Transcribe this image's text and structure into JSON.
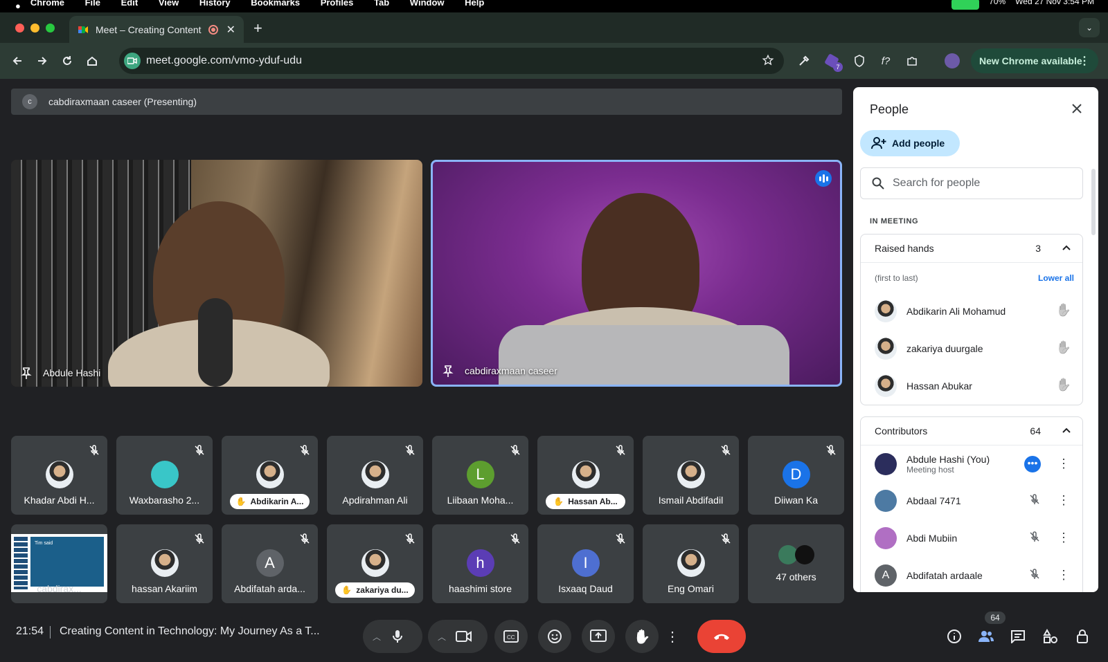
{
  "mac_menu": {
    "app": "Chrome",
    "items": [
      "File",
      "Edit",
      "View",
      "History",
      "Bookmarks",
      "Profiles",
      "Tab",
      "Window",
      "Help"
    ],
    "status_battery": "70%",
    "clock": "Wed 27 Nov  3:54 PM"
  },
  "browser": {
    "tab_title": "Meet – Creating Content i",
    "url": "meet.google.com/vmo-yduf-udu",
    "ext_badge": "7",
    "new_chrome_label": "New Chrome available"
  },
  "meet": {
    "presenting_initial": "c",
    "presenting_label": "cabdiraxmaan caseer (Presenting)",
    "featured": [
      {
        "name": "Abdule Hashi"
      },
      {
        "name": "cabdiraxmaan caseer"
      }
    ],
    "row1": [
      {
        "name": "Khadar Abdi H...",
        "type": "photo"
      },
      {
        "name": "Waxbarasho 2...",
        "type": "photo"
      },
      {
        "name": "Abdikarin A...",
        "type": "photo",
        "raised": true
      },
      {
        "name": "Apdirahman Ali",
        "type": "photo"
      },
      {
        "name": "Liibaan Moha...",
        "type": "letter",
        "letter": "L",
        "color": "#5d9e2f"
      },
      {
        "name": "Hassan Ab...",
        "type": "photo",
        "raised": true
      },
      {
        "name": "Ismail Abdifadil",
        "type": "photo"
      },
      {
        "name": "Diiwan Ka",
        "type": "letter",
        "letter": "D",
        "color": "#1a73e8"
      }
    ],
    "row2": [
      {
        "name": "cabdirax...",
        "type": "screen"
      },
      {
        "name": "hassan Akariim",
        "type": "photo"
      },
      {
        "name": "Abdifatah arda...",
        "type": "letter",
        "letter": "A",
        "color": "#5f6368"
      },
      {
        "name": "zakariya du...",
        "type": "photo",
        "raised": true
      },
      {
        "name": "haashimi store",
        "type": "letter",
        "letter": "h",
        "color": "#5b3db5"
      },
      {
        "name": "Isxaaq Daud",
        "type": "letter",
        "letter": "I",
        "color": "#4e6fd1"
      },
      {
        "name": "Eng Omari",
        "type": "photo"
      },
      {
        "name": "47 others",
        "type": "others"
      }
    ],
    "screen_preview_text": "Tim said",
    "time": "21:54",
    "meeting_title": "Creating Content in Technology: My Journey As a T...",
    "people_badge": "64"
  },
  "panel": {
    "title": "People",
    "add_people": "Add people",
    "search_placeholder": "Search for people",
    "in_meeting": "IN MEETING",
    "raised": {
      "label": "Raised hands",
      "count": "3",
      "order": "(first to last)",
      "lower_all": "Lower all",
      "people": [
        {
          "name": "Abdikarin Ali Mohamud"
        },
        {
          "name": "zakariya duurgale"
        },
        {
          "name": "Hassan Abukar"
        }
      ]
    },
    "contributors": {
      "label": "Contributors",
      "count": "64",
      "people": [
        {
          "name": "Abdule Hashi (You)",
          "sub": "Meeting host"
        },
        {
          "name": "Abdaal 7471"
        },
        {
          "name": "Abdi Mubiin"
        },
        {
          "name": "Abdifatah ardaale",
          "letter": "A"
        }
      ]
    }
  },
  "colors": {
    "accent": "#1a73e8",
    "end_call": "#ea4335",
    "chip": "#c2e7ff"
  }
}
